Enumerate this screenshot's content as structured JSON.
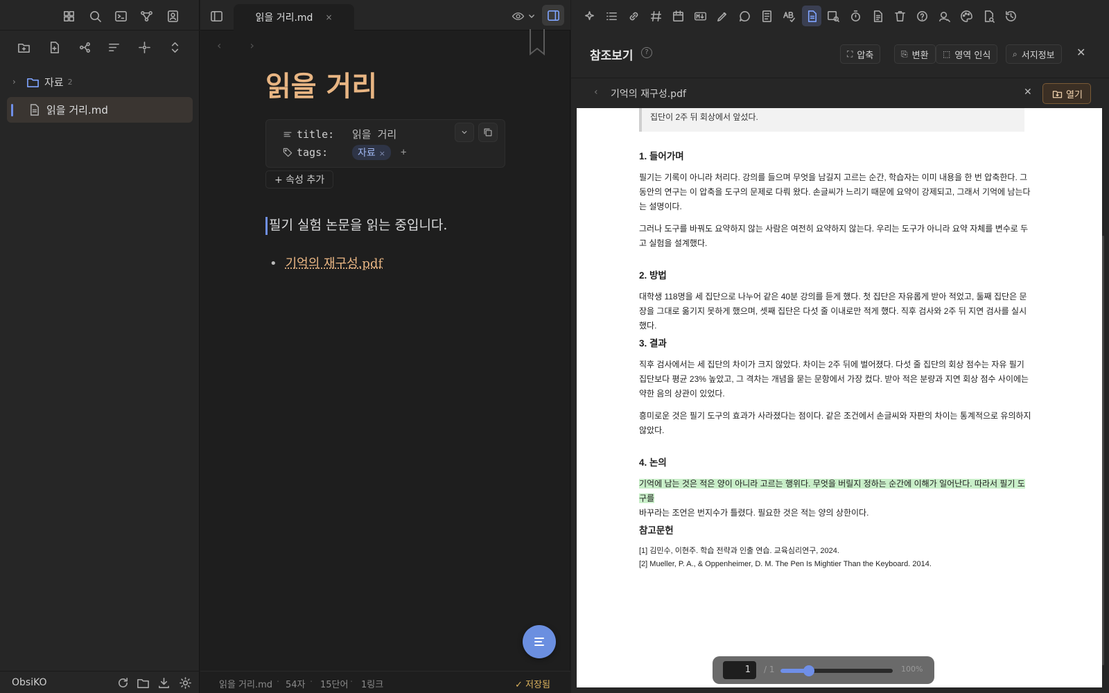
{
  "sidebar": {
    "tree": {
      "folder": {
        "name": "자료",
        "count": "2"
      },
      "file": {
        "name": "읽을 거리.md"
      }
    },
    "vault_name": "ObsiKO"
  },
  "editor": {
    "tab_title": "읽을 거리.md",
    "tab_close": "×",
    "note_title": "읽을 거리",
    "properties": [
      {
        "key": "title:",
        "value": "읽을 거리"
      },
      {
        "key": "tags:",
        "tag": "자료",
        "tag_remove": "×",
        "add": "+"
      }
    ],
    "add_property": "+ 속성 추가",
    "body": "필기 실험 논문을 읽는 중입니다.",
    "link_bullet": "•",
    "link": "기억의 재구성.pdf",
    "status": {
      "file": "읽을 거리.md",
      "chars": "54자",
      "words": "15단어",
      "links": "1링크",
      "saved": "✓ 저장됨"
    }
  },
  "right_panel": {
    "title": "참조보기",
    "help": "?",
    "buttons": [
      {
        "label": "압축",
        "glyph": "⛶"
      },
      {
        "label": "변환",
        "glyph": "⎘"
      },
      {
        "label": "영역 인식",
        "glyph": "⬚"
      },
      {
        "label": "서지정보",
        "glyph": "⌕"
      }
    ],
    "close": "✕",
    "file": {
      "back": "‹",
      "name": "기억의 재구성.pdf",
      "close": "✕",
      "open": "열기"
    },
    "pdf": {
      "quote": "집단이 2주 뒤 회상에서 앞섰다.",
      "sections": [
        {
          "heading": "1. 들어가며",
          "paragraphs": [
            "필기는 기록이 아니라 처리다. 강의를 들으며 무엇을 남길지 고르는 순간, 학습자는 이미 내용을 한 번 압축한다. 그동안의 연구는 이 압축을 도구의 문제로 다뤄 왔다. 손글씨가 느리기 때문에 요약이 강제되고, 그래서 기억에 남는다는 설명이다.",
            "그러나 도구를 바꿔도 요약하지 않는 사람은 여전히 요약하지 않는다. 우리는 도구가 아니라 요약 자체를 변수로 두고 실험을 설계했다."
          ]
        },
        {
          "heading": "2. 방법",
          "paragraphs": [
            "대학생 118명을 세 집단으로 나누어 같은 40분 강의를 듣게 했다. 첫 집단은 자유롭게 받아 적었고, 둘째 집단은 문장을 그대로 옮기지 못하게 했으며, 셋째 집단은 다섯 줄 이내로만 적게 했다. 직후 검사와 2주 뒤 지연 검사를 실시했다."
          ]
        },
        {
          "heading": "3. 결과",
          "paragraphs": [
            "직후 검사에서는 세 집단의 차이가 크지 않았다. 차이는 2주 뒤에 벌어졌다. 다섯 줄 집단의 회상 점수는 자유 필기 집단보다 평균 23% 높았고, 그 격차는 개념을 묻는 문항에서 가장 컸다. 받아 적은 분량과 지연 회상 점수 사이에는 약한 음의 상관이 있었다.",
            "흥미로운 것은 필기 도구의 효과가 사라졌다는 점이다. 같은 조건에서 손글씨와 자판의 차이는 통계적으로 유의하지 않았다."
          ]
        },
        {
          "heading": "4. 논의",
          "highlight": "기억에 남는 것은 적은 양이 아니라 고르는 행위다. 무엇을 버릴지 정하는 순간에 이해가 일어난다. 따라서 필기 도구를",
          "paragraphs": [
            "바꾸라는 조언은 번지수가 틀렸다. 필요한 것은 적는 양의 상한이다."
          ]
        },
        {
          "heading": "참고문헌",
          "refs": [
            "[1] 김민수, 이현주. 학습 전략과 인출 연습. 교육심리연구, 2024.",
            "[2] Mueller, P. A., & Oppenheimer, D. M. The Pen Is Mightier Than the Keyboard. 2014."
          ]
        }
      ],
      "page": "1",
      "page_total": "/ 1",
      "zoom": "100%",
      "zoom_level": 0.25
    }
  },
  "colors": {
    "accent": "#6f8fe8",
    "title": "#e8b583",
    "saved": "#d9b15c",
    "highlight": "#c9efc9"
  }
}
